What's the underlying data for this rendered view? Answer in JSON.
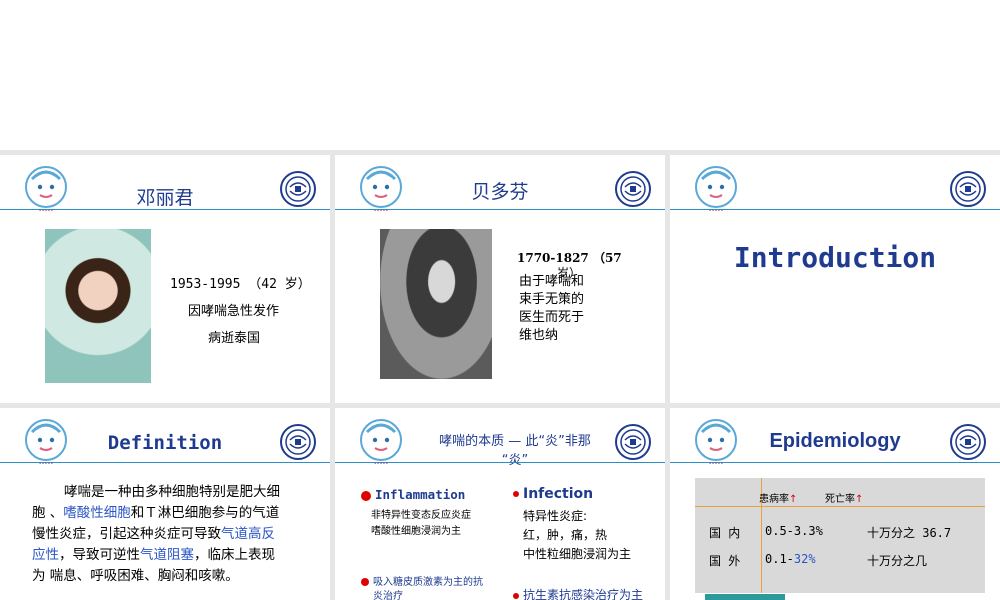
{
  "slides": {
    "s1": {
      "title": "邓丽君",
      "line1": "1953-1995 （42 岁）",
      "line2": "因哮喘急性发作",
      "line3": "病逝泰国"
    },
    "s2": {
      "title": "贝多芬",
      "years": "1770-1827 （57",
      "years_suffix": "岁）",
      "text": [
        "由于哮喘和",
        "束手无策的",
        "医生而死于",
        "维也纳"
      ]
    },
    "s3": {
      "title": "Introduction"
    },
    "s4": {
      "title": "Definition",
      "l1": "哮喘是一种由多种细胞特别是肥大细",
      "l2a": "胞 、",
      "l2b": "嗜酸性细胞",
      "l2c": "和Ｔ淋巴细胞参与的气道",
      "l3a": "慢性炎症，引起这种炎症可导致",
      "l3b": "气道高反",
      "l4a": "应性",
      "l4b": "，导致可逆性",
      "l4c": "气道阻塞",
      "l4d": "，临床上表现",
      "l5": "为 喘息、呼吸困难、胸闷和咳嗽。"
    },
    "s5": {
      "title_l1": "哮喘的本质 — 此“炎”非那",
      "title_l2": "“炎”",
      "left_head": "Inflammation",
      "left_l1": "非特异性变态反应炎症",
      "left_l2": "嗜酸性细胞浸润为主",
      "left_bottom": "吸入糖皮质激素为主的抗",
      "left_bottom2": "炎治疗",
      "right_head": "Infection",
      "right_l1": "特异性炎症:",
      "right_l2": "红，肿，痛，热",
      "right_l3": "中性粒细胞浸润为主",
      "right_bottom": "抗生素抗感染治疗为主"
    },
    "s6": {
      "title": "Epidemiology",
      "col1": "患病率",
      "col2": "死亡率",
      "row1_label": "国 内",
      "row1_v1": "0.5-3.3%",
      "row1_v2": "十万分之 36.7",
      "row2_label": "国 外",
      "row2_v1a": "0.1-",
      "row2_v1b": "32%",
      "row2_v2": "十万分之几"
    }
  },
  "colors": {
    "accent": "#2a8fc7",
    "title": "#1f3b8f",
    "red": "#e00000"
  }
}
